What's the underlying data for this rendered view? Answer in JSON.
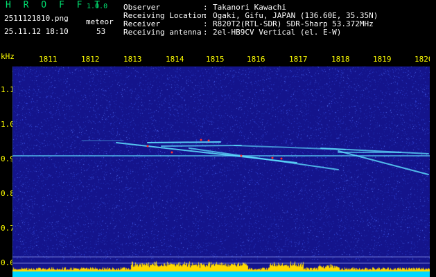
{
  "app": {
    "title": "H R O F F T",
    "version": "1.0.0"
  },
  "file": {
    "name": "2511121810.png",
    "timestamp": "25.11.12 18:10"
  },
  "meteor": {
    "label": "meteor",
    "count": "53"
  },
  "info": [
    {
      "key": "Observer",
      "value": "Takanori Kawachi"
    },
    {
      "key": "Receiving Location",
      "value": "Ogaki, Gifu, JAPAN (136.60E, 35.35N)"
    },
    {
      "key": "Receiver",
      "value": "R820T2(RTL-SDR) SDR-Sharp 53.372MHz"
    },
    {
      "key": "Receiving antenna",
      "value": "2el-HB9CV Vertical (el. E-W)"
    }
  ],
  "separator": ":",
  "y_axis": {
    "unit": "kHz",
    "ticks": [
      "1.1",
      "1.0",
      "0.9",
      "0.8",
      "0.7",
      "0.6"
    ]
  },
  "x_axis": {
    "ticks": [
      "1811",
      "1812",
      "1813",
      "1814",
      "1815",
      "1816",
      "1817",
      "1818",
      "1819",
      "1820"
    ]
  },
  "colors": {
    "background": "#14148c",
    "text_green": "#00e070",
    "text_yellow": "#ffff00",
    "trace": "#4fd0ff",
    "noise": "#2e3fd0",
    "hot": "#ff3030",
    "bars": "#ffd800",
    "base": "#00d8ff"
  }
}
